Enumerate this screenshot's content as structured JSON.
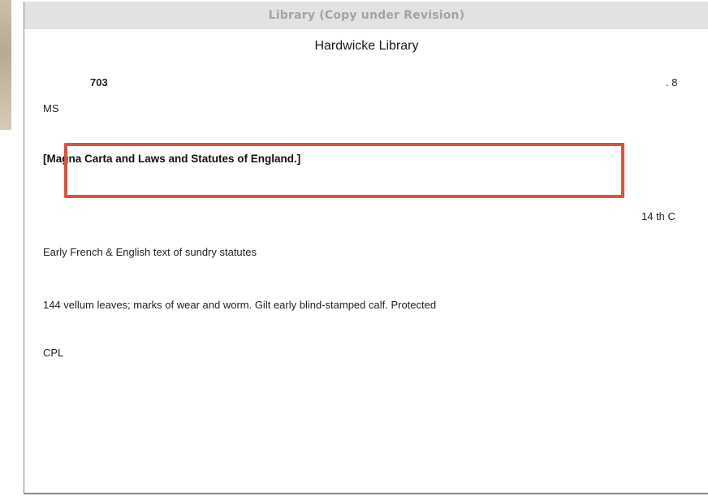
{
  "window": {
    "title": "Library (Copy under Revision)"
  },
  "record": {
    "library_name": "Hardwicke Library",
    "class_number": "703",
    "copy_number": ". 8",
    "ms_label": "MS",
    "title": "[Magna Carta and Laws and Statutes of England.]",
    "date": "14 th C",
    "note": "Early French & English text of sundry statutes",
    "physical_description": "144 vellum leaves; marks of wear and worm. Gilt early blind-stamped calf. Protected",
    "cpl": "CPL"
  },
  "colors": {
    "highlight": "#d9533f",
    "titlebar": "#e2e2e2",
    "titlebar_text": "#a3a3a3"
  }
}
